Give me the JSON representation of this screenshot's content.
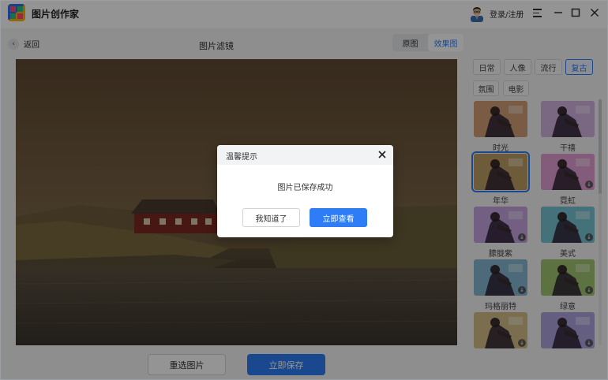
{
  "app": {
    "title": "图片创作家",
    "login_label": "登录/注册"
  },
  "subbar": {
    "back_label": "返回",
    "page_title": "图片滤镜",
    "view_toggle": [
      {
        "label": "原图",
        "active": false
      },
      {
        "label": "效果图",
        "active": true
      }
    ]
  },
  "filters": {
    "tabs": [
      {
        "label": "日常",
        "active": false
      },
      {
        "label": "人像",
        "active": false
      },
      {
        "label": "流行",
        "active": false
      },
      {
        "label": "复古",
        "active": true
      },
      {
        "label": "氛围",
        "active": false
      },
      {
        "label": "电影",
        "active": false
      }
    ],
    "items": [
      {
        "label": "时光",
        "selected": false,
        "download": false,
        "tint": "#c88a5a"
      },
      {
        "label": "干禧",
        "selected": false,
        "download": false,
        "tint": "#c9a0d8"
      },
      {
        "label": "年华",
        "selected": true,
        "download": false,
        "tint": "#b08840"
      },
      {
        "label": "霓虹",
        "selected": false,
        "download": true,
        "tint": "#d98ac8"
      },
      {
        "label": "朦胧紫",
        "selected": false,
        "download": true,
        "tint": "#b890d8"
      },
      {
        "label": "美式",
        "selected": false,
        "download": true,
        "tint": "#5ab8c8"
      },
      {
        "label": "玛格丽特",
        "selected": false,
        "download": true,
        "tint": "#6aa8c8"
      },
      {
        "label": "绿意",
        "selected": false,
        "download": true,
        "tint": "#8ab850"
      },
      {
        "label": "",
        "selected": false,
        "download": true,
        "tint": "#c8b070"
      },
      {
        "label": "",
        "selected": false,
        "download": true,
        "tint": "#9a90d8"
      }
    ]
  },
  "actions": {
    "reselect_label": "重选图片",
    "save_label": "立即保存"
  },
  "dialog": {
    "title": "温馨提示",
    "message": "图片已保存成功",
    "ok_label": "我知道了",
    "view_label": "立即查看"
  },
  "colors": {
    "accent": "#2e7df6",
    "overlay": "rgba(0,0,0,0.42)"
  }
}
